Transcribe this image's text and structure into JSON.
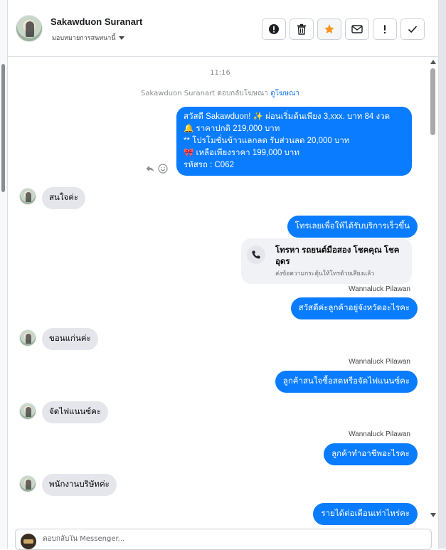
{
  "contact": {
    "name": "Sakawduon Suranart",
    "assign_label": "มอบหมายการสนทนานี้"
  },
  "actions": [
    {
      "name": "mark-spam-button",
      "icon": "exclamation-circle-icon"
    },
    {
      "name": "delete-button",
      "icon": "trash-icon"
    },
    {
      "name": "star-button",
      "icon": "star-icon",
      "color": "#f7931e"
    },
    {
      "name": "mark-unread-button",
      "icon": "envelope-icon"
    },
    {
      "name": "follow-up-button",
      "icon": "exclamation-icon"
    },
    {
      "name": "mark-done-button",
      "icon": "check-icon"
    }
  ],
  "conversation": {
    "timestamp": "11:16",
    "ad_note": "Sakawduon Suranart ตอบกลับโฆษณา",
    "ad_link": "ดูโฆษณา",
    "promo_lines": [
      "สวัสดี Sakawduon! ✨  ผ่อนเริ่มต้นเพียง 3,xxx. บาท 84 งวด",
      "🔔 ราคาปกติ 219,000 บาท",
      "** โปรโมชั่นข้าวแลกลด รับส่วนลด 20,000 บาท",
      "🎀  เหลือเพียงราคา 199,000 บาท",
      " รหัสรถ : C062"
    ],
    "msg_in_1": "สนใจค่ะ",
    "msg_out_1": "โทรเลยเพื่อให้ได้รับบริการเร็วขึ้น",
    "call_title": "โทรหา รถยนต์มือสอง โชคคุณ โชค อุดร",
    "call_sub": "ส่งข้อความกระตุ้นให้โทรด้วยเสียงแล้ว",
    "sender_1": "Wannaluck Pilawan",
    "msg_out_2": "สวัสดีค่ะลูกค้าอยู่จังหวัดอะไรคะ",
    "msg_in_2": "ขอนแก่นค่ะ",
    "sender_2": "Wannaluck Pilawan",
    "msg_out_3": "ลูกค้าสนใจซื้อสดหรือจัดไฟแนนซ์คะ",
    "msg_in_3": "จัดไฟแนนซ์คะ",
    "sender_3": "Wannaluck Pilawan",
    "msg_out_4": "ลูกค้าทำอาชีพอะไรคะ",
    "msg_in_4": "พนักงานบริษัทค่ะ",
    "msg_out_5": "รายได้ต่อเดือนเท่าไหร่คะ"
  },
  "composer": {
    "placeholder": "ตอบกลับใน Messenger..."
  },
  "colors": {
    "accent": "#0a7cff",
    "incoming": "#e4e6eb",
    "link": "#1877f2"
  }
}
